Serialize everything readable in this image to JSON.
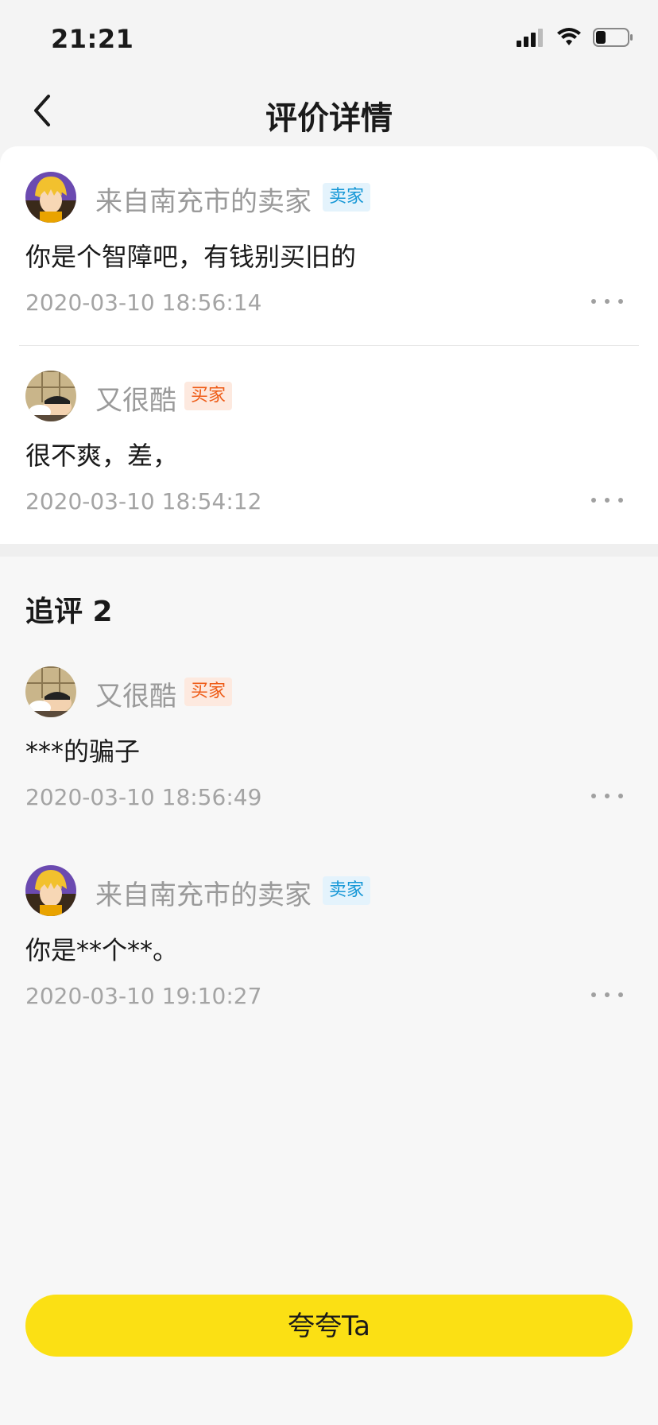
{
  "status_bar": {
    "time": "21:21"
  },
  "nav": {
    "title": "评价详情"
  },
  "comments": [
    {
      "username": "来自南充市的卖家",
      "role": "卖家",
      "text": "你是个智障吧，有钱别买旧的",
      "time": "2020-03-10 18:56:14"
    },
    {
      "username": "又很酷",
      "role": "买家",
      "text": "很不爽，差，",
      "time": "2020-03-10 18:54:12"
    }
  ],
  "followup": {
    "title": "追评 2",
    "items": [
      {
        "username": "又很酷",
        "role": "买家",
        "text": "***的骗子",
        "time": "2020-03-10 18:56:49"
      },
      {
        "username": "来自南充市的卖家",
        "role": "卖家",
        "text": "你是**个**。",
        "time": "2020-03-10 19:10:27"
      }
    ]
  },
  "action": {
    "praise_label": "夸夸Ta"
  },
  "colors": {
    "accent_yellow": "#fbe014",
    "seller_badge": "#1597d6",
    "buyer_badge": "#ee5b16"
  }
}
